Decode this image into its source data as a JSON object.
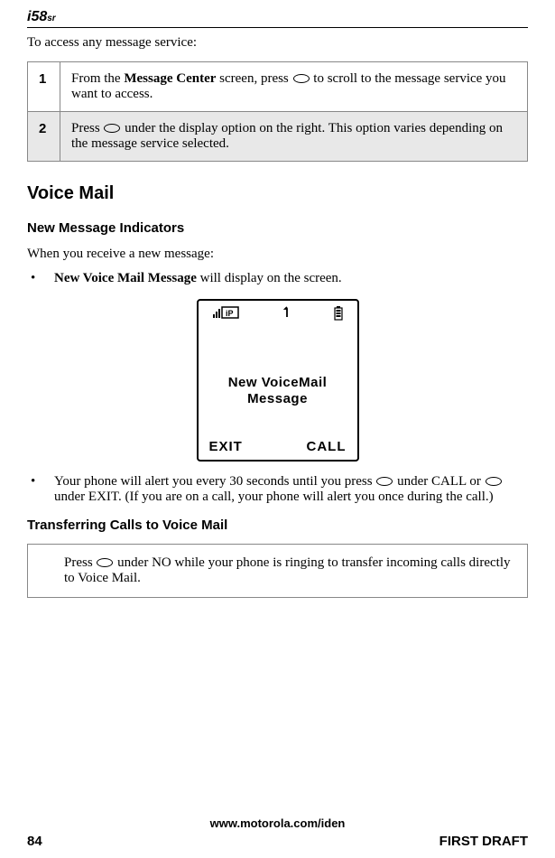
{
  "logo": {
    "main": "i58",
    "suffix": "sr"
  },
  "intro": "To access any message service:",
  "steps": [
    {
      "num": "1",
      "pre": "From the ",
      "bold": "Message Center",
      "mid": " screen, press ",
      "post": " to scroll to the message service you want to access."
    },
    {
      "num": "2",
      "pre": "Press ",
      "post": " under the display option on the right. This option varies depending on the message service selected."
    }
  ],
  "h2": "Voice Mail",
  "h3a": "New Message Indicators",
  "para1": "When you receive a new message:",
  "bullet1": {
    "bold": "New Voice Mail Message",
    "rest": " will display on the screen."
  },
  "screen": {
    "line1": "New VoiceMail",
    "line2": "Message",
    "softLeft": "EXIT",
    "softRight": "CALL"
  },
  "bullet2": {
    "pre": "Your phone will alert you every 30 seconds until you press ",
    "mid1": " under CALL or ",
    "post": " under EXIT. (If you are on a call, your phone will alert you once during the call.)"
  },
  "h3b": "Transferring Calls to Voice Mail",
  "transfer": {
    "pre": "Press ",
    "post": " under NO while your phone is ringing to transfer incoming calls directly to Voice Mail."
  },
  "footer": {
    "url": "www.motorola.com/iden",
    "page": "84",
    "draft": "FIRST DRAFT"
  }
}
